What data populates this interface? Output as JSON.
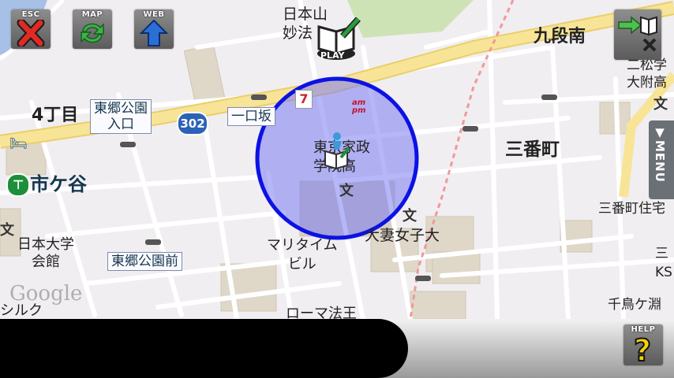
{
  "toolbar": {
    "esc_label": "ESC",
    "map_label": "MAP",
    "web_label": "WEB",
    "play_label": "PLAY",
    "help_label": "HELP"
  },
  "side_tab": {
    "menu_label": "▼MENU"
  },
  "map": {
    "google_watermark": "Google",
    "road_shield": "302",
    "labels": {
      "nihonzan_1": "日本山",
      "nihonzan_2": "妙法",
      "kudanminami": "九段南",
      "nishoufu_1": "二松学",
      "nishoufu_2": "大附高",
      "yonchome": "4丁目",
      "hongo_park_entrance_1": "東郷公園",
      "hongo_park_entrance_2": "入口",
      "ichiguchizaka": "一口坂",
      "tokyo_kasei_1": "東京家政",
      "tokyo_kasei_2": "学院高",
      "sanbancho": "三番町",
      "ichigaya": "市ケ谷",
      "nihon_univ_1": "日本大学",
      "nihon_univ_2": "会館",
      "hongo_park_front": "東郷公園前",
      "mariteimu_1": "マリタイム",
      "mariteimu_2": "ビル",
      "otsuma": "大妻女子大",
      "sanbancho_res": "三番町住宅",
      "roma_houou": "ローマ法王",
      "chidorigafuchi": "千鳥ケ淵",
      "shiruku": "シルク",
      "ks_1": "三",
      "ks_2": "KS",
      "bunkyo_mark": "文",
      "ampm": "am pm"
    }
  },
  "colors": {
    "radius_fill": "#7a7cf2",
    "radius_stroke": "#0c12e4",
    "major_road": "#f6dd7c",
    "rail_dash": "#ef9a9a",
    "water": "#a7c1e6",
    "park": "#cde3b6"
  }
}
